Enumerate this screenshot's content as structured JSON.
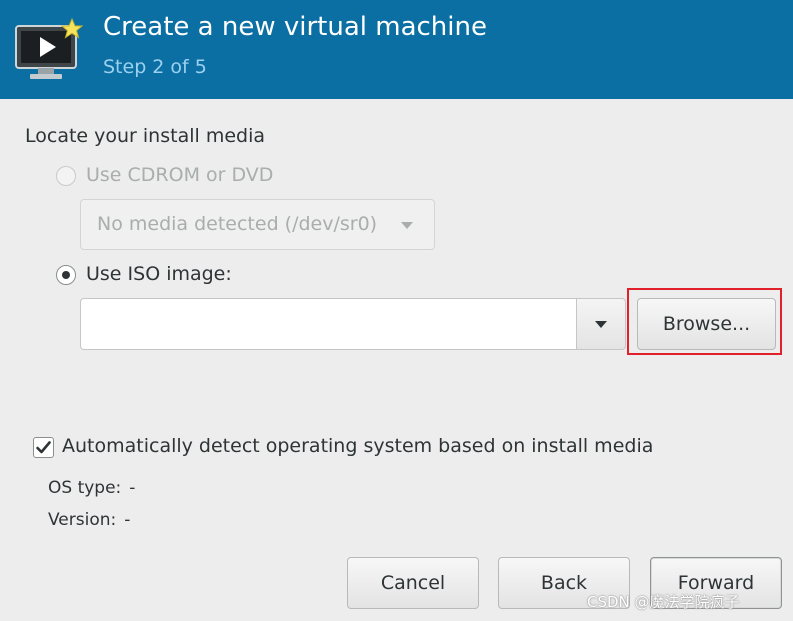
{
  "header": {
    "title": "Create a new virtual machine",
    "subtitle": "Step 2 of 5",
    "icon": "vm-monitor-icon"
  },
  "locate": {
    "section_label": "Locate your install media",
    "cdrom": {
      "label": "Use CDROM or DVD",
      "selected": false,
      "enabled": false,
      "combo_value": "No media detected (/dev/sr0)"
    },
    "iso": {
      "label": "Use ISO image:",
      "selected": true,
      "path_value": "",
      "browse_label": "Browse..."
    }
  },
  "auto_detect": {
    "label": "Automatically detect operating system based on install media",
    "checked": true,
    "os_type_label": "OS type:",
    "os_type_value": "-",
    "version_label": "Version:",
    "version_value": "-"
  },
  "footer": {
    "cancel_label": "Cancel",
    "back_label": "Back",
    "forward_label": "Forward"
  },
  "watermark": "CSDN @魔法学院疯子",
  "colors": {
    "header_bg": "#0b6fa4",
    "subtitle": "#9cd0ef",
    "highlight_box": "#e0202a"
  }
}
